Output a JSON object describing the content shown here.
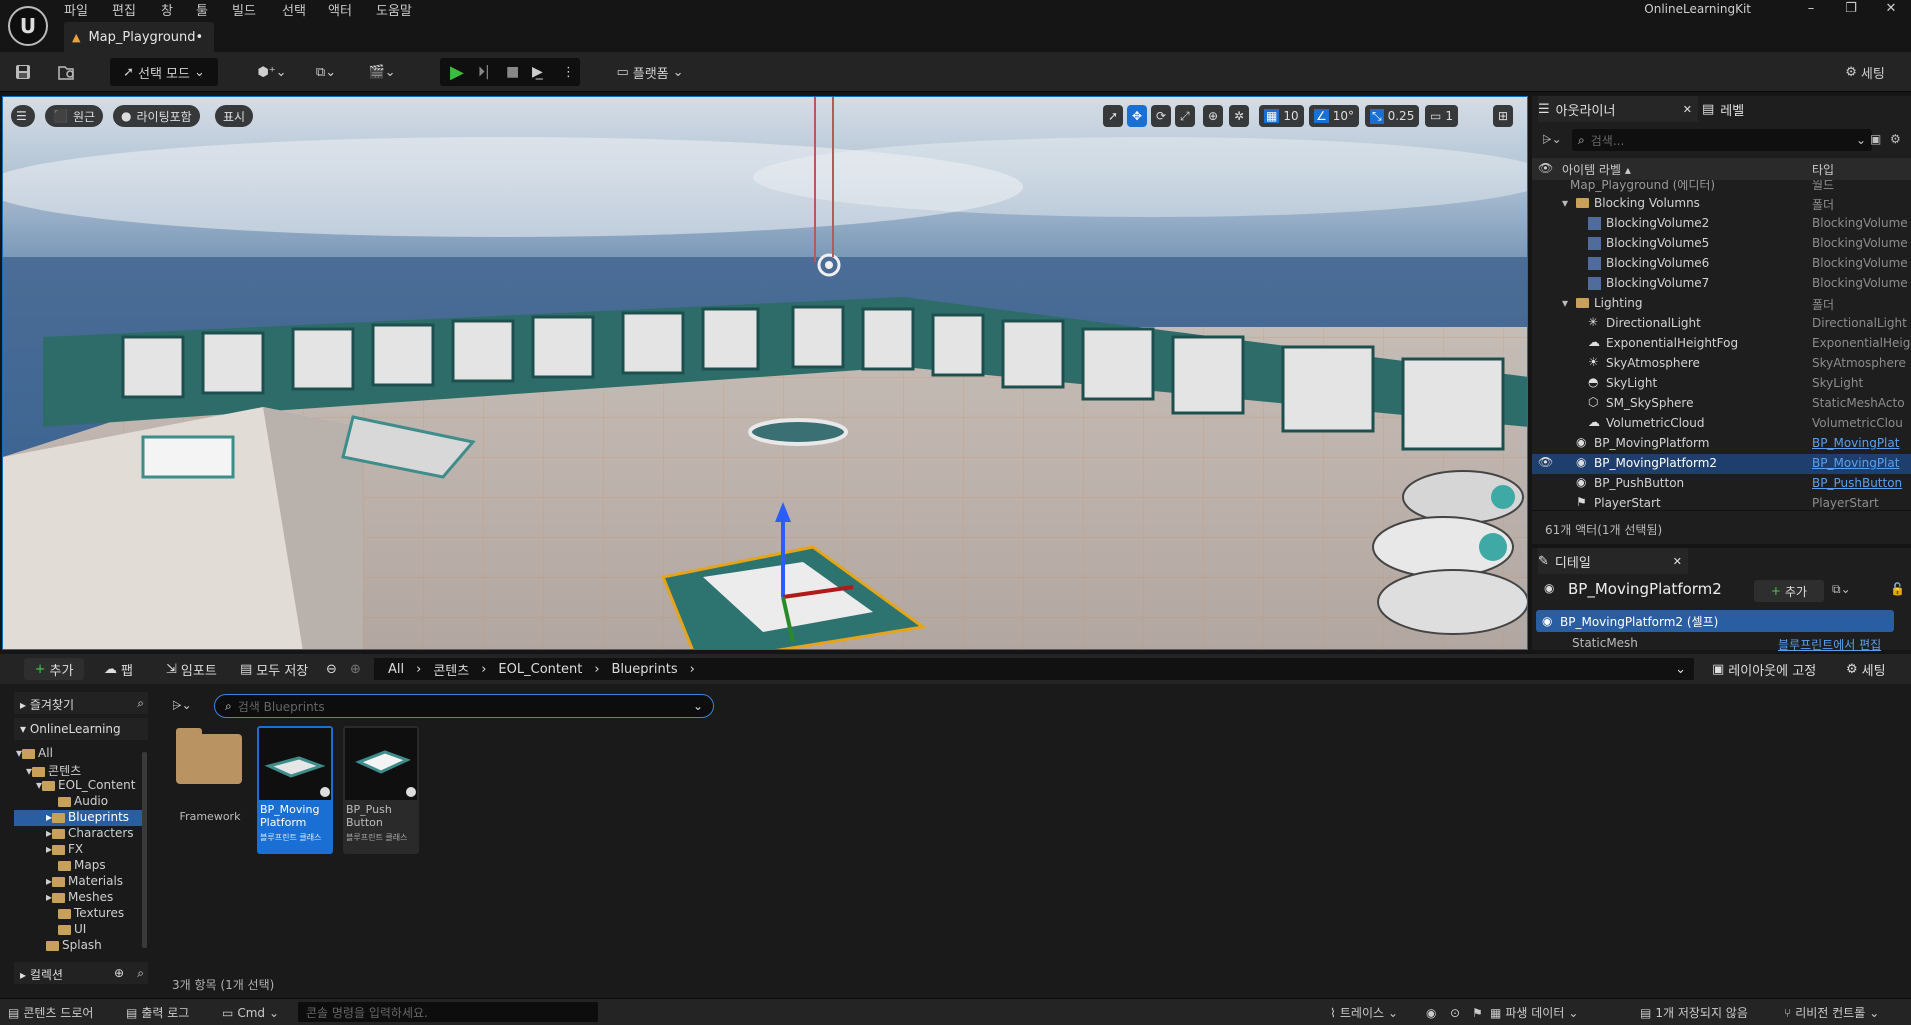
{
  "menu": [
    "파일",
    "편집",
    "창",
    "툴",
    "빌드",
    "선택",
    "액터",
    "도움말"
  ],
  "tab": {
    "title": "Map_Playground•"
  },
  "project": "OnlineLearningKit",
  "toolbar": {
    "select_mode": "선택 모드",
    "platforms": "플랫폼",
    "settings": "세팅"
  },
  "viewport": {
    "perspective": "원근",
    "lit": "라이팅포함",
    "show": "표시",
    "grid": "10",
    "rotation": "10°",
    "scale": "0.25",
    "camera": "1"
  },
  "outliner": {
    "tab": "아웃라이너",
    "levels_tab": "레벨",
    "search_placeholder": "검색...",
    "col_label": "아이템 라벨 ▴",
    "col_type": "타입",
    "rows": [
      {
        "name": "Map_Playground (에디터)",
        "type": "월드"
      },
      {
        "name": "Blocking Volumns",
        "type": "폴더"
      },
      {
        "name": "BlockingVolume2",
        "type": "BlockingVolume"
      },
      {
        "name": "BlockingVolume5",
        "type": "BlockingVolume"
      },
      {
        "name": "BlockingVolume6",
        "type": "BlockingVolume"
      },
      {
        "name": "BlockingVolume7",
        "type": "BlockingVolume"
      },
      {
        "name": "Lighting",
        "type": "폴더"
      },
      {
        "name": "DirectionalLight",
        "type": "DirectionalLight"
      },
      {
        "name": "ExponentialHeightFog",
        "type": "ExponentialHeig"
      },
      {
        "name": "SkyAtmosphere",
        "type": "SkyAtmosphere"
      },
      {
        "name": "SkyLight",
        "type": "SkyLight"
      },
      {
        "name": "SM_SkySphere",
        "type": "StaticMeshActo"
      },
      {
        "name": "VolumetricCloud",
        "type": "VolumetricClou"
      },
      {
        "name": "BP_MovingPlatform",
        "type": "BP_MovingPlat"
      },
      {
        "name": "BP_MovingPlatform2",
        "type": "BP_MovingPlat"
      },
      {
        "name": "BP_PushButton",
        "type": "BP_PushButton"
      },
      {
        "name": "PlayerStart",
        "type": "PlayerStart"
      }
    ],
    "footer": "61개 액터(1개 선택됨)"
  },
  "details": {
    "tab": "디테일",
    "name": "BP_MovingPlatform2",
    "add": "추가",
    "self": "BP_MovingPlatform2 (셀프)",
    "component": "StaticMesh",
    "edit_bp": "블루프린트에서 편집"
  },
  "content_browser": {
    "add": "추가",
    "import": "임포트",
    "save_all": "모두 저장",
    "fab": "팹",
    "path": [
      "All",
      "콘텐츠",
      "EOL_Content",
      "Blueprints"
    ],
    "lock_layout": "레이아웃에 고정",
    "settings": "세팅",
    "favorites": "즐겨찾기",
    "project_root": "OnlineLearning",
    "tree": [
      "All",
      "콘텐츠",
      "EOL_Content",
      "Audio",
      "Blueprints",
      "Characters",
      "FX",
      "Maps",
      "Materials",
      "Meshes",
      "Textures",
      "UI",
      "Splash"
    ],
    "collections": "컬렉션",
    "search_placeholder": "검색 Blueprints",
    "assets": [
      {
        "name": "Framework",
        "kind": ""
      },
      {
        "name": "BP_Moving Platform",
        "kind": "블루프린트 클래스"
      },
      {
        "name": "BP_Push Button",
        "kind": "블루프린트 클래스"
      }
    ],
    "count": "3개 항목 (1개 선택)"
  },
  "statusbar": {
    "drawer": "콘텐츠 드로어",
    "output": "출력 로그",
    "cmd": "Cmd",
    "cmd_placeholder": "콘솔 명령을 입력하세요.",
    "trace": "트레이스",
    "derived": "파생 데이터",
    "unsaved": "1개 저장되지 않음",
    "revision": "리비전 컨트롤"
  }
}
